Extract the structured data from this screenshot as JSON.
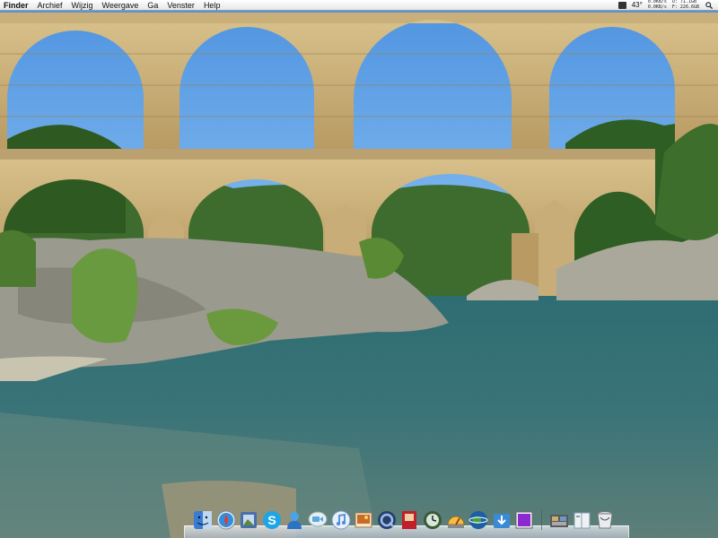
{
  "menubar": {
    "app_name": "Finder",
    "menus": [
      "Archief",
      "Wijzig",
      "Weergave",
      "Ga",
      "Venster",
      "Help"
    ],
    "temperature": "43°",
    "net_in": "0.0KB/s",
    "net_out": "0.0KB/s",
    "disk_u": "U: 71.1GB",
    "disk_f": "F: 226.6GB",
    "icons": [
      "battery-icon",
      "spotlight-icon"
    ]
  },
  "dock": {
    "apps": [
      {
        "name": "finder",
        "icon": "finder-icon",
        "color": "#3a7bd5"
      },
      {
        "name": "safari",
        "icon": "safari-icon",
        "color": "#2f8fdc"
      },
      {
        "name": "preview",
        "icon": "preview-icon",
        "color": "#4a6fa8"
      },
      {
        "name": "skype",
        "icon": "skype-icon",
        "color": "#1ea5e6"
      },
      {
        "name": "ichat",
        "icon": "ichat-icon",
        "color": "#4aa3e6"
      },
      {
        "name": "facetime",
        "icon": "video-chat-icon",
        "color": "#59a8e0"
      },
      {
        "name": "itunes",
        "icon": "itunes-icon",
        "color": "#4b8bd8"
      },
      {
        "name": "iphoto",
        "icon": "iphoto-icon",
        "color": "#c86a2a"
      },
      {
        "name": "quicktime",
        "icon": "quicktime-icon",
        "color": "#2a3e6a"
      },
      {
        "name": "photo-booth",
        "icon": "photo-booth-icon",
        "color": "#c0202a"
      },
      {
        "name": "time-machine",
        "icon": "time-machine-icon",
        "color": "#3a5a3a"
      },
      {
        "name": "system-monitor",
        "icon": "gauge-icon",
        "color": "#f0c040"
      },
      {
        "name": "google-earth",
        "icon": "google-earth-icon",
        "color": "#1a5fa8"
      },
      {
        "name": "downloads-app",
        "icon": "download-icon",
        "color": "#3a8ad8"
      },
      {
        "name": "frontrow",
        "icon": "purple-square-icon",
        "color": "#8a2ad0"
      }
    ],
    "stacks": [
      {
        "name": "documents-stack",
        "icon": "documents-stack-icon"
      },
      {
        "name": "downloads-stack",
        "icon": "downloads-stack-icon"
      },
      {
        "name": "trash",
        "icon": "trash-icon"
      }
    ]
  }
}
